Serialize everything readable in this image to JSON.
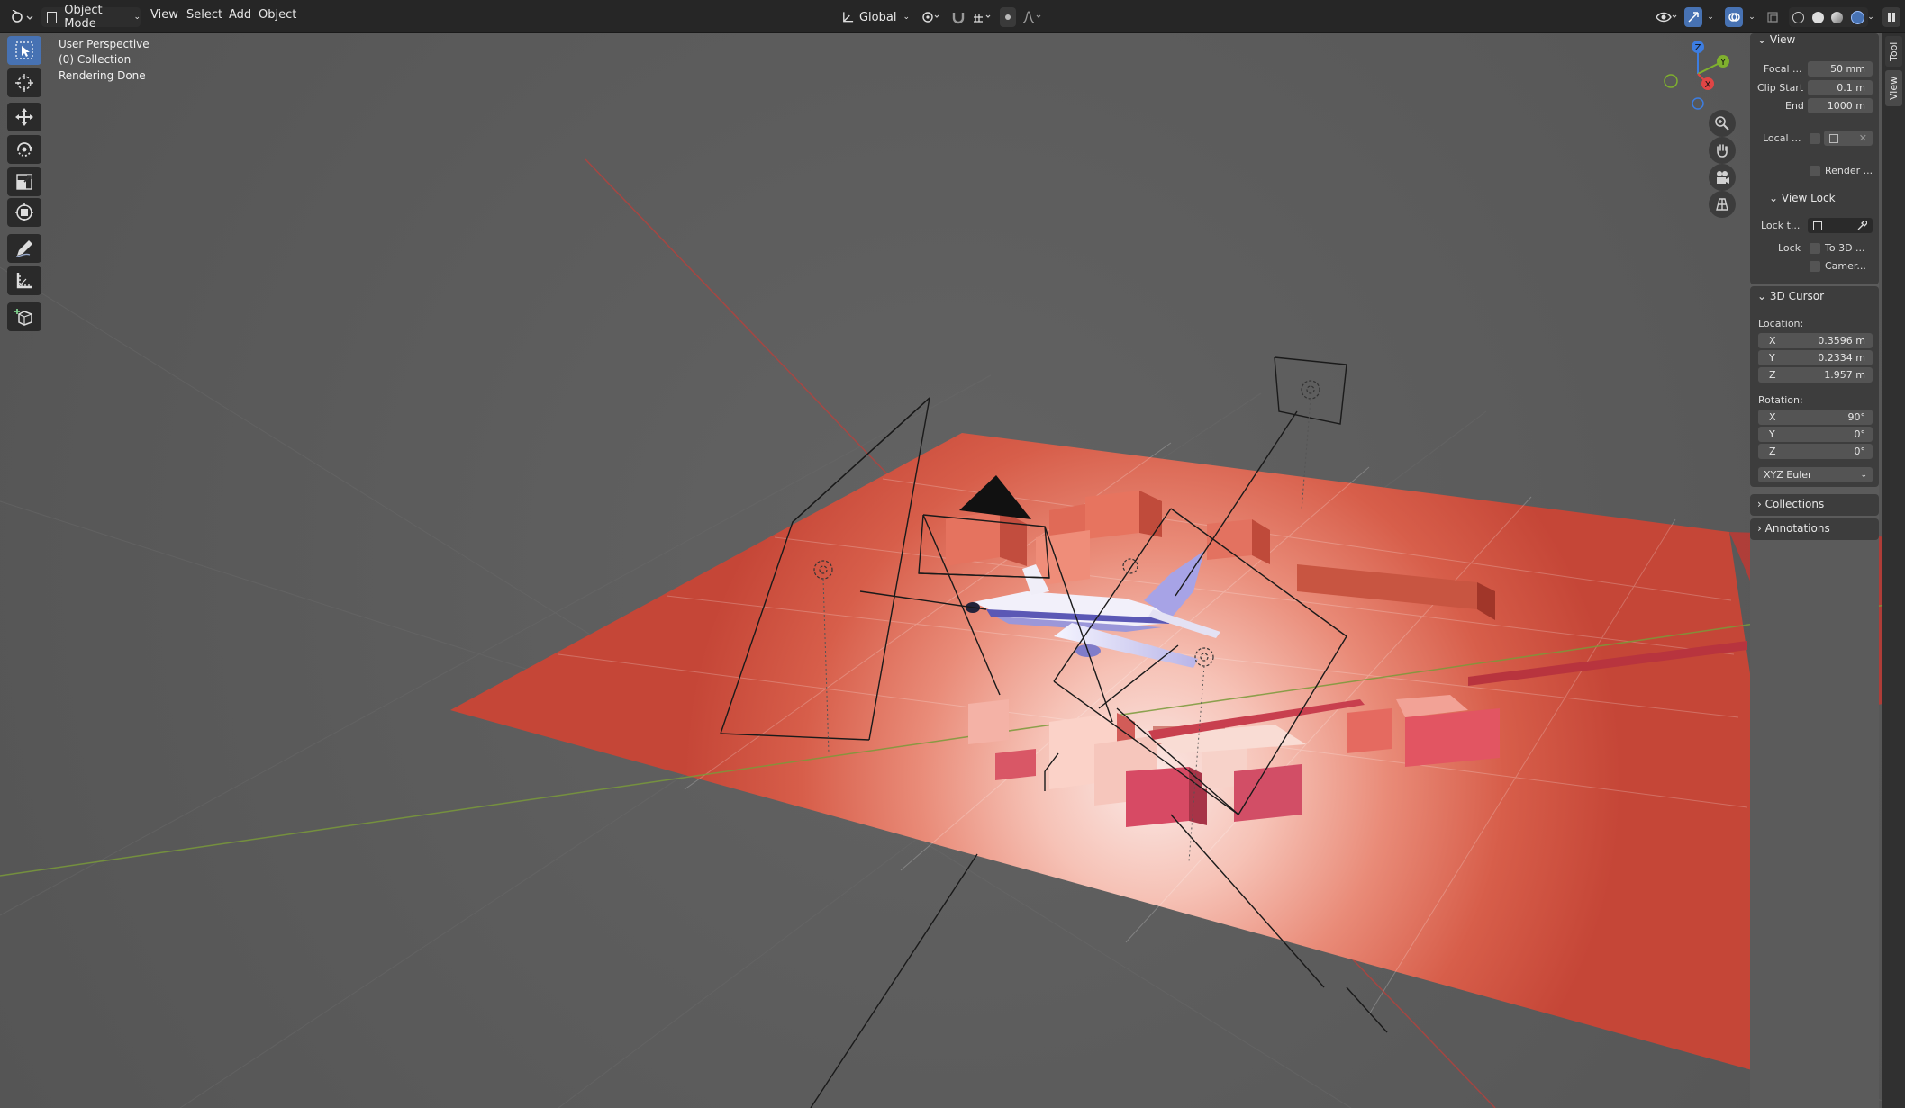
{
  "header": {
    "mode_label": "Object Mode",
    "menus": [
      "View",
      "Select",
      "Add",
      "Object"
    ],
    "orientation_label": "Global"
  },
  "toolbar": {
    "tools": [
      "select-box",
      "cursor",
      "move",
      "rotate",
      "scale",
      "transform",
      "annotate",
      "measure",
      "add-cube"
    ]
  },
  "viewport": {
    "view_name": "User Perspective",
    "collection": "(0) Collection",
    "status": "Rendering Done",
    "gizmo": {
      "z": "Z",
      "y": "Y",
      "x": "X"
    }
  },
  "sidebar": {
    "tabs": [
      "Tool",
      "View"
    ],
    "view_panel": {
      "title": "View",
      "focal_label": "Focal ...",
      "focal_value": "50 mm",
      "clip_start_label": "Clip Start",
      "clip_start_value": "0.1 m",
      "end_label": "End",
      "end_value": "1000 m",
      "local_label": "Local ...",
      "render_label": "Render ..."
    },
    "view_lock": {
      "title": "View Lock",
      "lock_to_label": "Lock t...",
      "lock_label": "Lock",
      "to_3d_label": "To 3D ...",
      "camera_label": "Camer..."
    },
    "cursor_panel": {
      "title": "3D Cursor",
      "location_label": "Location:",
      "loc_x": "0.3596 m",
      "loc_y": "0.2334 m",
      "loc_z": "1.957 m",
      "rotation_label": "Rotation:",
      "rot_x": "90°",
      "rot_y": "0°",
      "rot_z": "0°",
      "rotation_mode": "XYZ Euler",
      "axis_x": "X",
      "axis_y": "Y",
      "axis_z": "Z"
    },
    "collections_title": "Collections",
    "annotations_title": "Annotations"
  },
  "colors": {
    "accent": "#4772b3",
    "viewport_bg": "#5b5b5b",
    "header_bg": "#262626"
  }
}
